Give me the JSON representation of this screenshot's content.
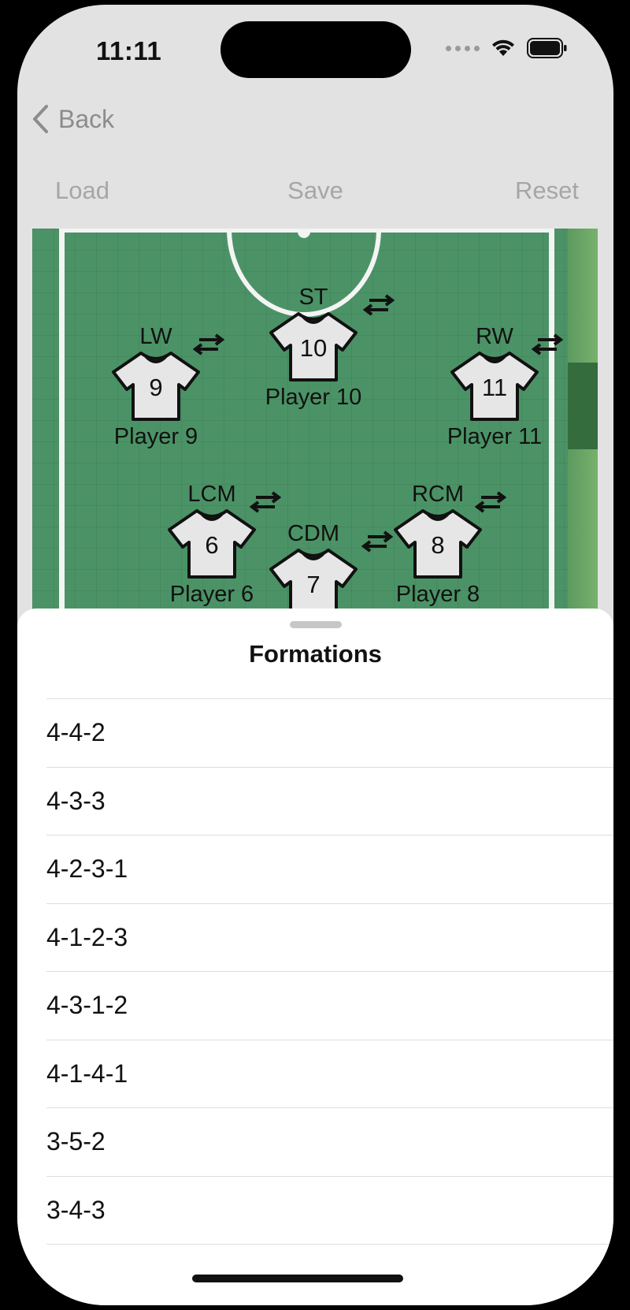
{
  "status_bar": {
    "time": "11:11"
  },
  "nav": {
    "back_label": "Back"
  },
  "toolbar": {
    "load_label": "Load",
    "save_label": "Save",
    "reset_label": "Reset"
  },
  "pitch": {
    "colors": {
      "grass": "#4b9366",
      "lines": "#f4f4f4",
      "shirt": "#e6e6e6"
    },
    "players": [
      {
        "position": "ST",
        "number": "10",
        "name": "Player 10"
      },
      {
        "position": "LW",
        "number": "9",
        "name": "Player 9"
      },
      {
        "position": "RW",
        "number": "11",
        "name": "Player 11"
      },
      {
        "position": "LCM",
        "number": "6",
        "name": "Player 6"
      },
      {
        "position": "RCM",
        "number": "8",
        "name": "Player 8"
      },
      {
        "position": "CDM",
        "number": "7",
        "name": ""
      }
    ]
  },
  "sheet": {
    "title": "Formations",
    "formations": [
      "4-4-2",
      "4-3-3",
      "4-2-3-1",
      "4-1-2-3",
      "4-3-1-2",
      "4-1-4-1",
      "3-5-2",
      "3-4-3"
    ]
  }
}
